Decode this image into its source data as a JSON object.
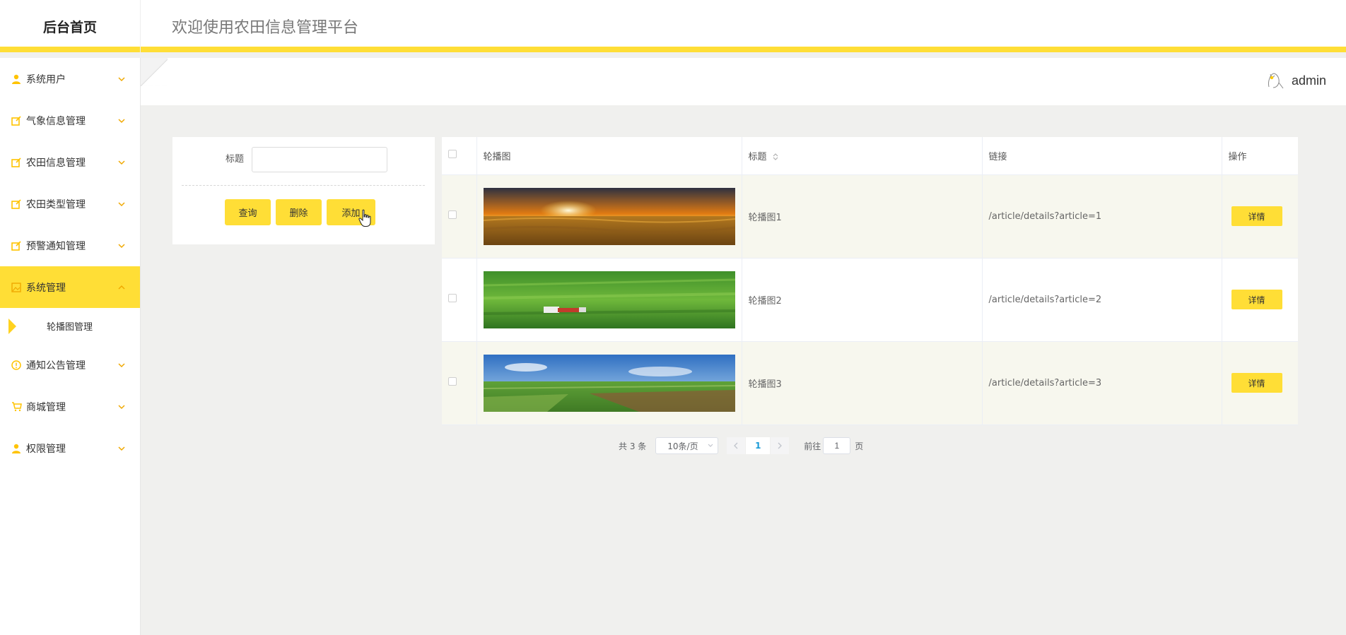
{
  "header": {
    "brand": "后台首页",
    "title": "欢迎使用农田信息管理平台"
  },
  "user": {
    "name": "admin"
  },
  "sidebar": {
    "items": [
      {
        "label": "系统用户",
        "icon": "user-icon"
      },
      {
        "label": "气象信息管理",
        "icon": "edit-square-icon"
      },
      {
        "label": "农田信息管理",
        "icon": "edit-square-icon"
      },
      {
        "label": "农田类型管理",
        "icon": "edit-square-icon"
      },
      {
        "label": "预警通知管理",
        "icon": "edit-square-icon"
      },
      {
        "label": "系统管理",
        "icon": "picture-icon",
        "active": true,
        "expanded": true
      },
      {
        "label": "通知公告管理",
        "icon": "info-circle-icon"
      },
      {
        "label": "商城管理",
        "icon": "cart-icon"
      },
      {
        "label": "权限管理",
        "icon": "user-icon"
      }
    ],
    "subitem": {
      "label": "轮播图管理"
    }
  },
  "search": {
    "title_label": "标题",
    "title_value": "",
    "query_button": "查询",
    "delete_button": "删除",
    "add_button": "添加"
  },
  "table": {
    "columns": [
      "轮播图",
      "标题",
      "链接",
      "操作"
    ],
    "rows": [
      {
        "title": "轮播图1",
        "link": "/article/details?article=1",
        "image": "sunset-wheat-field",
        "action": "详情"
      },
      {
        "title": "轮播图2",
        "link": "/article/details?article=2",
        "image": "green-field-tractor",
        "action": "详情"
      },
      {
        "title": "轮播图3",
        "link": "/article/details?article=3",
        "image": "farmland-blue-sky",
        "action": "详情"
      }
    ]
  },
  "pagination": {
    "total_text": "共 3 条",
    "page_size": "10条/页",
    "current_page": "1",
    "goto_label": "前往",
    "goto_value": "1",
    "goto_suffix": "页"
  },
  "colors": {
    "accent": "#ffde36",
    "icon": "#ffc300",
    "page_background": "#f0f0ee",
    "row_stripe": "#f7f7ee"
  }
}
